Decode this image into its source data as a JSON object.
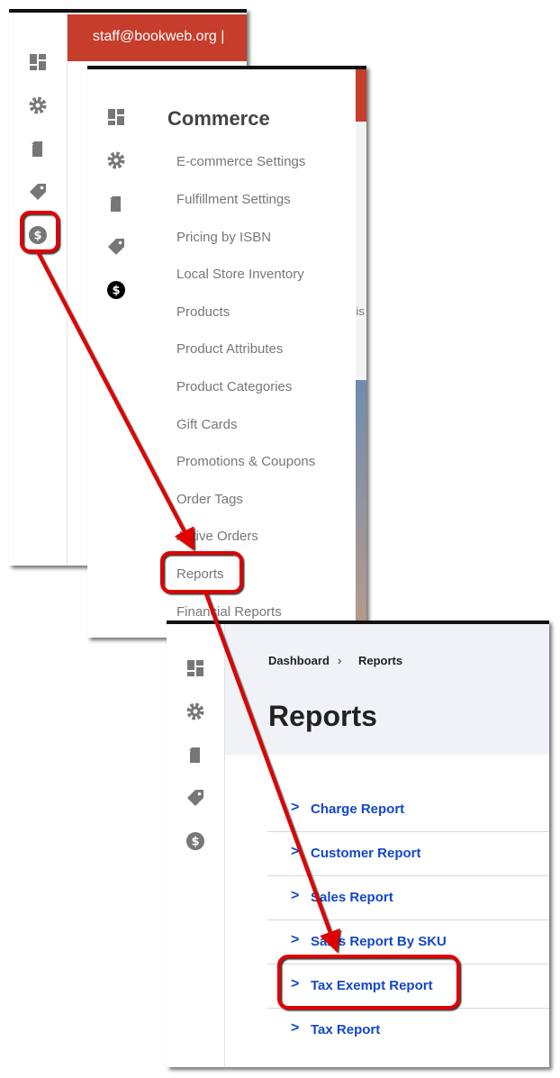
{
  "panel1": {
    "header_text": "staff@bookweb.org |",
    "header_color": "#c63d2b"
  },
  "sidebar_icons": [
    "dashboard-icon",
    "gear-icon",
    "document-icon",
    "tag-icon",
    "dollar-icon"
  ],
  "panel2": {
    "menu_title": "Commerce",
    "menu_items": [
      "E-commerce Settings",
      "Fulfillment Settings",
      "Pricing by ISBN",
      "Local Store Inventory",
      "Products",
      "Product Attributes",
      "Product Categories",
      "Gift Cards",
      "Promotions & Coupons",
      "Order Tags",
      "Active Orders",
      "Reports",
      "Financial Reports"
    ],
    "partial_right_text": "vis"
  },
  "panel3": {
    "breadcrumb": [
      "Dashboard",
      "Reports"
    ],
    "breadcrumb_sep": "›",
    "title": "Reports",
    "reports": [
      "Charge Report",
      "Customer Report",
      "Sales Report",
      "Sales Report By SKU",
      "Tax Exempt Report",
      "Tax Report"
    ]
  },
  "colors": {
    "highlight": "#e00000",
    "link": "#1447c8",
    "header_bg": "#f1f2f7"
  }
}
